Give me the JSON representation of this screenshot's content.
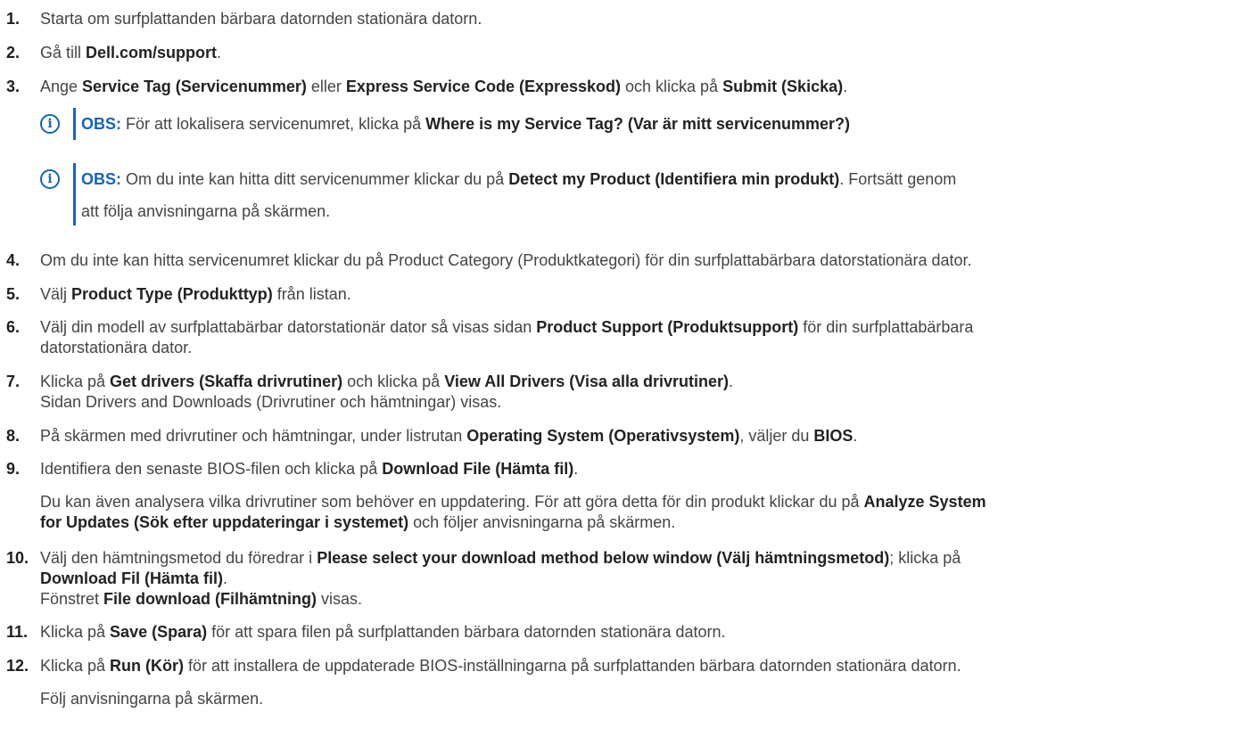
{
  "steps": [
    {
      "num": "1.",
      "text": "Starta om surfplattanden bärbara datornden stationära datorn."
    },
    {
      "num": "2.",
      "t1": "Gå till ",
      "b1": "Dell.com/support",
      "t2": "."
    },
    {
      "num": "3.",
      "t1": "Ange ",
      "b1": "Service Tag (Servicenummer)",
      "t2": " eller ",
      "b2": "Express Service Code (Expresskod)",
      "t3": " och klicka på ",
      "b3": "Submit (Skicka)",
      "t4": "."
    },
    {
      "num": "4.",
      "text": "Om du inte kan hitta servicenumret klickar du på Product Category (Produktkategori) för din surfplattabärbara datorstationära dator."
    },
    {
      "num": "5.",
      "t1": "Välj ",
      "b1": "Product Type (Produkttyp)",
      "t2": " från listan."
    },
    {
      "num": "6.",
      "t1": "Välj din modell av surfplattabärbar datorstationär dator så visas sidan ",
      "b1": "Product Support (Produktsupport)",
      "t2": " för din surfplattabärbara",
      "line2": "datorstationära dator."
    },
    {
      "num": "7.",
      "t1": "Klicka på ",
      "b1": "Get drivers (Skaffa drivrutiner)",
      "t2": " och klicka på ",
      "b2": "View All Drivers (Visa alla drivrutiner)",
      "t3": ".",
      "line2": "Sidan Drivers and Downloads (Drivrutiner och hämtningar) visas."
    },
    {
      "num": "8.",
      "t1": "På skärmen med drivrutiner och hämtningar, under listrutan ",
      "b1": "Operating System (Operativsystem)",
      "t2": ", väljer du ",
      "b2": "BIOS",
      "t3": "."
    },
    {
      "num": "9.",
      "t1": "Identifiera den senaste BIOS-filen och klicka på ",
      "b1": "Download File (Hämta fil)",
      "t2": ".",
      "p2a": "Du kan även analysera vilka drivrutiner som behöver en uppdatering. För att göra detta för din produkt klickar du på ",
      "p2b": "Analyze System",
      "p2c": "for Updates (Sök efter uppdateringar i systemet)",
      "p2d": " och följer anvisningarna på skärmen."
    },
    {
      "num": "10.",
      "t1": "Välj den hämtningsmetod du föredrar i ",
      "b1": "Please select your download method below window (Välj hämtningsmetod)",
      "t2": "; klicka på",
      "line2": "Download Fil (Hämta fil)",
      "line2b": ".",
      "line3a": "Fönstret ",
      "line3b": "File download (Filhämtning)",
      "line3c": " visas."
    },
    {
      "num": "11.",
      "t1": "Klicka på ",
      "b1": "Save (Spara)",
      "t2": " för att spara filen på surfplattanden bärbara datornden stationära datorn."
    },
    {
      "num": "12.",
      "t1": "Klicka på ",
      "b1": "Run (Kör)",
      "t2": " för att installera de uppdaterade BIOS-inställningarna på surfplattanden bärbara datornden stationära datorn.",
      "p2": "Följ anvisningarna på skärmen."
    }
  ],
  "notes": [
    {
      "label": "OBS:",
      "t1": " För att lokalisera servicenumret, klicka på ",
      "b1": "Where is my Service Tag? (Var är mitt servicenummer?)"
    },
    {
      "label": "OBS:",
      "t1": " Om du inte kan hitta ditt servicenummer klickar du på ",
      "b1": "Detect my Product (Identifiera min produkt)",
      "t2": ". Fortsätt genom",
      "line2": "att följa anvisningarna på skärmen."
    }
  ]
}
